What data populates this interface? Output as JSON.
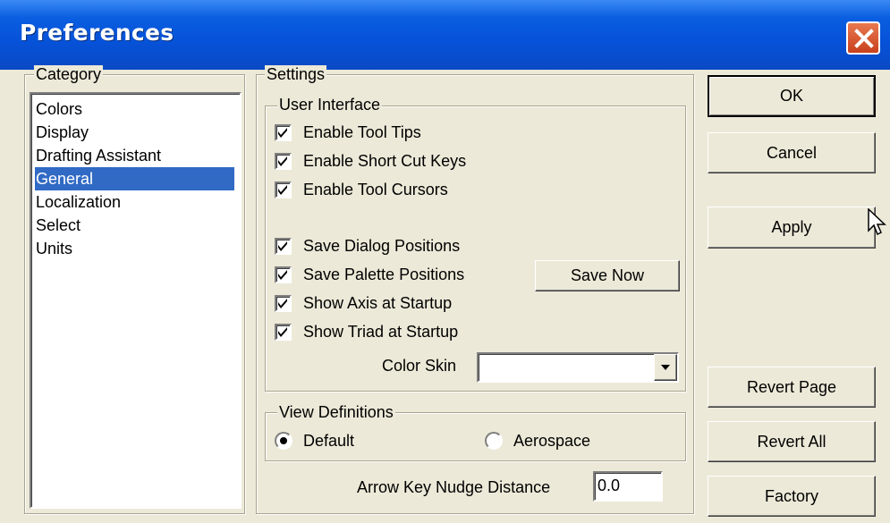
{
  "window": {
    "title": "Preferences"
  },
  "category": {
    "label": "Category",
    "items": [
      "Colors",
      "Display",
      "Drafting Assistant",
      "General",
      "Localization",
      "Select",
      "Units"
    ],
    "selected": "General"
  },
  "settings": {
    "label": "Settings",
    "user_interface": {
      "label": "User Interface",
      "checkboxes": [
        {
          "label": "Enable Tool Tips",
          "checked": true
        },
        {
          "label": "Enable Short Cut Keys",
          "checked": true
        },
        {
          "label": "Enable Tool Cursors",
          "checked": true
        },
        {
          "label": "Save Dialog Positions",
          "checked": true
        },
        {
          "label": "Save Palette Positions",
          "checked": true
        },
        {
          "label": "Show Axis at Startup",
          "checked": true
        },
        {
          "label": "Show Triad at Startup",
          "checked": true
        }
      ],
      "save_now_label": "Save Now",
      "color_skin_label": "Color Skin",
      "color_skin_value": ""
    },
    "view_definitions": {
      "label": "View Definitions",
      "options": [
        {
          "label": "Default",
          "selected": true
        },
        {
          "label": "Aerospace",
          "selected": false
        }
      ]
    },
    "nudge": {
      "label": "Arrow Key Nudge Distance",
      "value": "0.0"
    }
  },
  "buttons": {
    "ok": "OK",
    "cancel": "Cancel",
    "apply": "Apply",
    "revert_page": "Revert Page",
    "revert_all": "Revert All",
    "factory": "Factory"
  }
}
